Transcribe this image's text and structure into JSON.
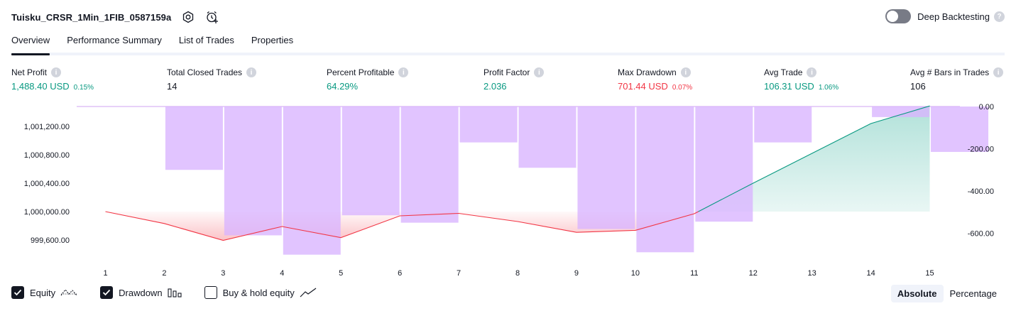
{
  "header": {
    "title": "Tuisku_CRSR_1Min_1FIB_0587159a",
    "deep_backtesting_label": "Deep Backtesting"
  },
  "tabs": [
    {
      "label": "Overview"
    },
    {
      "label": "Performance Summary"
    },
    {
      "label": "List of Trades"
    },
    {
      "label": "Properties"
    }
  ],
  "metrics": [
    {
      "label": "Net Profit",
      "value": "1,488.40 USD",
      "pct": "0.15%"
    },
    {
      "label": "Total Closed Trades",
      "value": "14"
    },
    {
      "label": "Percent Profitable",
      "value": "64.29%"
    },
    {
      "label": "Profit Factor",
      "value": "2.036"
    },
    {
      "label": "Max Drawdown",
      "value": "701.44 USD",
      "pct": "0.07%"
    },
    {
      "label": "Avg Trade",
      "value": "106.31 USD",
      "pct": "1.06%"
    },
    {
      "label": "Avg # Bars in Trades",
      "value": "106"
    }
  ],
  "colors": {
    "equity_line": "#f23645",
    "equity_fill_loss": "#f23645",
    "equity_line_gain": "#089981",
    "equity_fill_gain": "#22ab94",
    "drawdown_bar": "#d9b3ff",
    "positive": "#089981",
    "negative": "#f23645"
  },
  "chart_data": {
    "type": "bar",
    "categories": [
      "1",
      "2",
      "3",
      "4",
      "5",
      "6",
      "7",
      "8",
      "9",
      "10",
      "11",
      "12",
      "13",
      "14",
      "15"
    ],
    "series": [
      {
        "name": "Equity",
        "type": "line",
        "axis": "left",
        "values": [
          1000000,
          999832,
          999595,
          999790,
          999633,
          999940,
          999975,
          999860,
          999708,
          999736,
          999970,
          1000400,
          1000820,
          1001240,
          1001488
        ]
      },
      {
        "name": "Drawdown",
        "type": "bar",
        "axis": "right",
        "values": [
          0,
          -300,
          -610,
          -701.44,
          -515,
          -550,
          -170,
          -290,
          -580,
          -690,
          -545,
          -170,
          0,
          -50,
          -215
        ]
      }
    ],
    "left_axis": {
      "ticks": [
        "1,001,200.00",
        "1,000,800.00",
        "1,000,400.00",
        "1,000,000.00",
        "999,600.00"
      ]
    },
    "right_axis": {
      "ticks": [
        "0.00",
        "-200.00",
        "-400.00",
        "-600.00"
      ]
    },
    "legend": [
      {
        "label": "Equity",
        "checked": true
      },
      {
        "label": "Drawdown",
        "checked": true
      },
      {
        "label": "Buy & hold equity",
        "checked": false
      }
    ]
  },
  "view_modes": {
    "absolute": "Absolute",
    "percentage": "Percentage"
  }
}
